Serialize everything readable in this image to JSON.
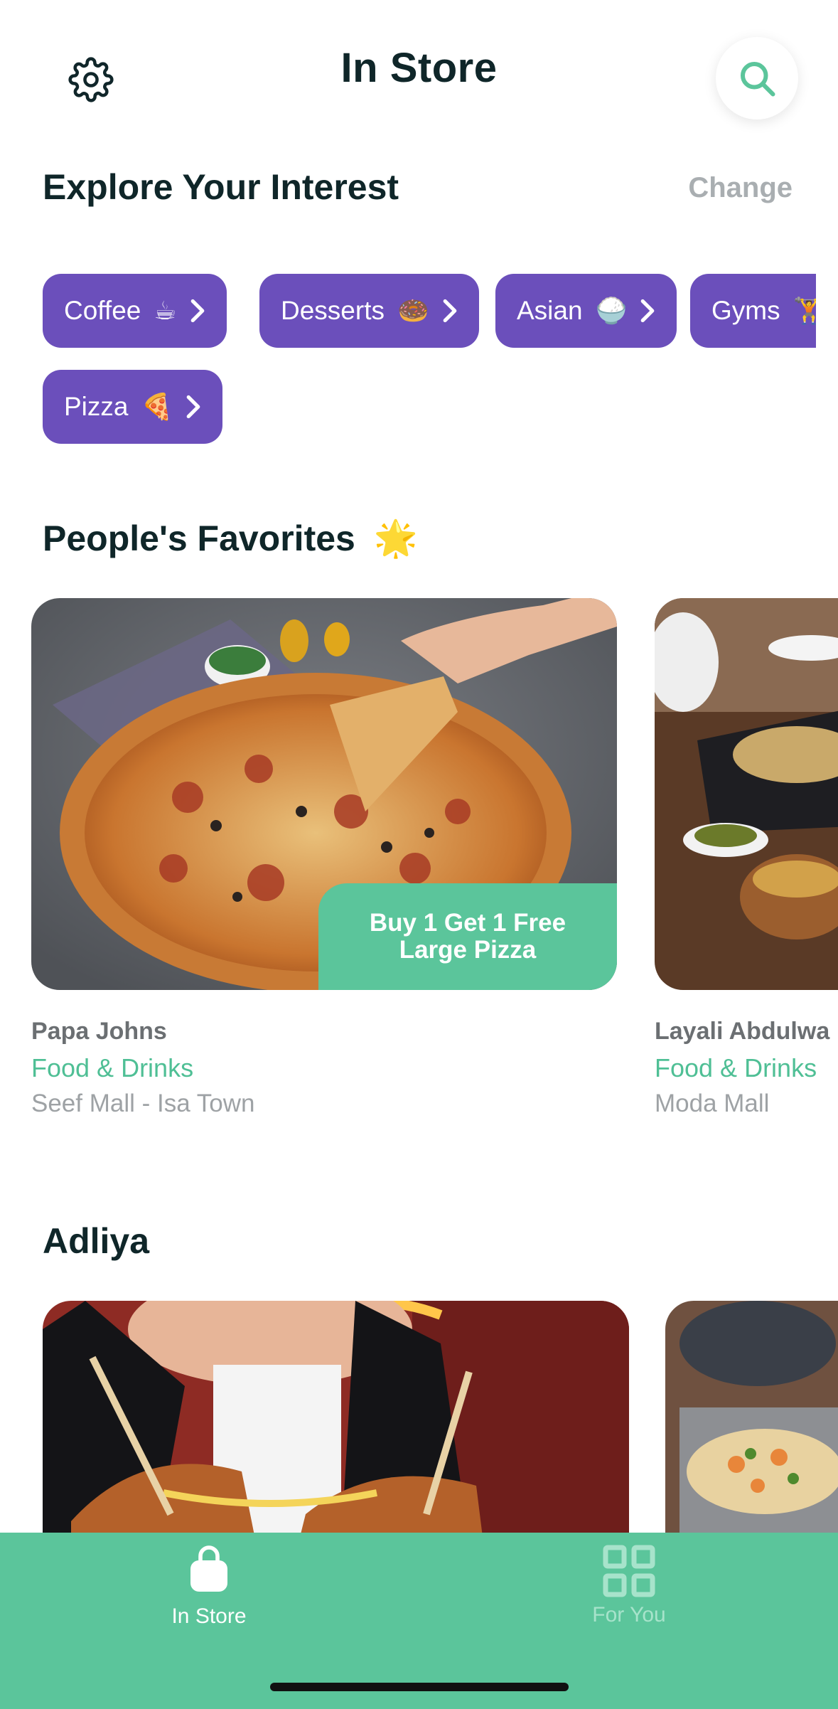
{
  "header": {
    "title": "In Store",
    "settings_icon": "gear-icon",
    "search_icon": "search-icon"
  },
  "interests": {
    "title": "Explore Your Interest",
    "change_label": "Change",
    "chips": [
      {
        "label": "Coffee",
        "emoji": "☕"
      },
      {
        "label": "Desserts",
        "emoji": "🍩"
      },
      {
        "label": "Asian",
        "emoji": "🍚"
      },
      {
        "label": "Gyms",
        "emoji": "🏋️"
      },
      {
        "label": "Pizza",
        "emoji": "🍕"
      }
    ]
  },
  "favorites": {
    "title": "People's Favorites",
    "title_emoji": "🌟",
    "cards": [
      {
        "promo_line1": "Buy 1 Get 1 Free",
        "promo_line2": "Large Pizza",
        "name": "Papa Johns",
        "category": "Food & Drinks",
        "location": "Seef Mall - Isa Town"
      },
      {
        "name": "Layali Abdulwa",
        "category": "Food & Drinks",
        "location": "Moda Mall"
      }
    ]
  },
  "adliya": {
    "title": "Adliya"
  },
  "bottom_nav": {
    "items": [
      {
        "label": "In Store",
        "icon": "shopping-bag-icon",
        "active": true
      },
      {
        "label": "For You",
        "icon": "grid-icon",
        "active": false
      }
    ]
  },
  "colors": {
    "accent": "#5bc59b",
    "chip": "#6b4fbb",
    "title": "#0f2629"
  }
}
